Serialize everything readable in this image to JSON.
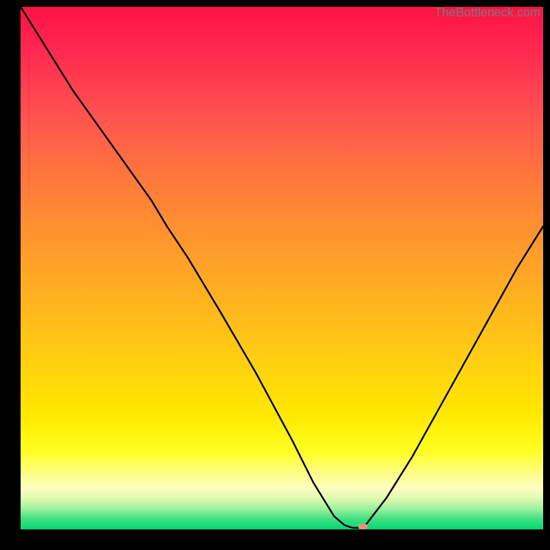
{
  "watermark": "TheBottleneck.com",
  "chart_data": {
    "type": "line",
    "title": "",
    "xlabel": "",
    "ylabel": "",
    "xlim": [
      0,
      100
    ],
    "ylim": [
      0,
      100
    ],
    "curve": {
      "x": [
        0,
        5,
        10,
        15,
        20,
        25,
        28,
        32,
        38,
        45,
        52,
        56,
        60,
        62,
        63.5,
        65,
        66,
        70,
        75,
        80,
        85,
        90,
        95,
        100
      ],
      "y": [
        100,
        92,
        84,
        77,
        70,
        63,
        58,
        52,
        42,
        30,
        17,
        9,
        2.5,
        0.8,
        0.3,
        0.3,
        0.8,
        6,
        14,
        23,
        32,
        41,
        50,
        58
      ]
    },
    "flat_bottom_x": [
      63,
      66
    ],
    "marker": {
      "x": 65.5,
      "y": 0.5,
      "color": "#e8927c"
    },
    "gradient": {
      "top": "#ff1144",
      "mid_upper": "#ff9030",
      "mid_lower": "#ffe800",
      "bottom": "#00d974"
    }
  }
}
